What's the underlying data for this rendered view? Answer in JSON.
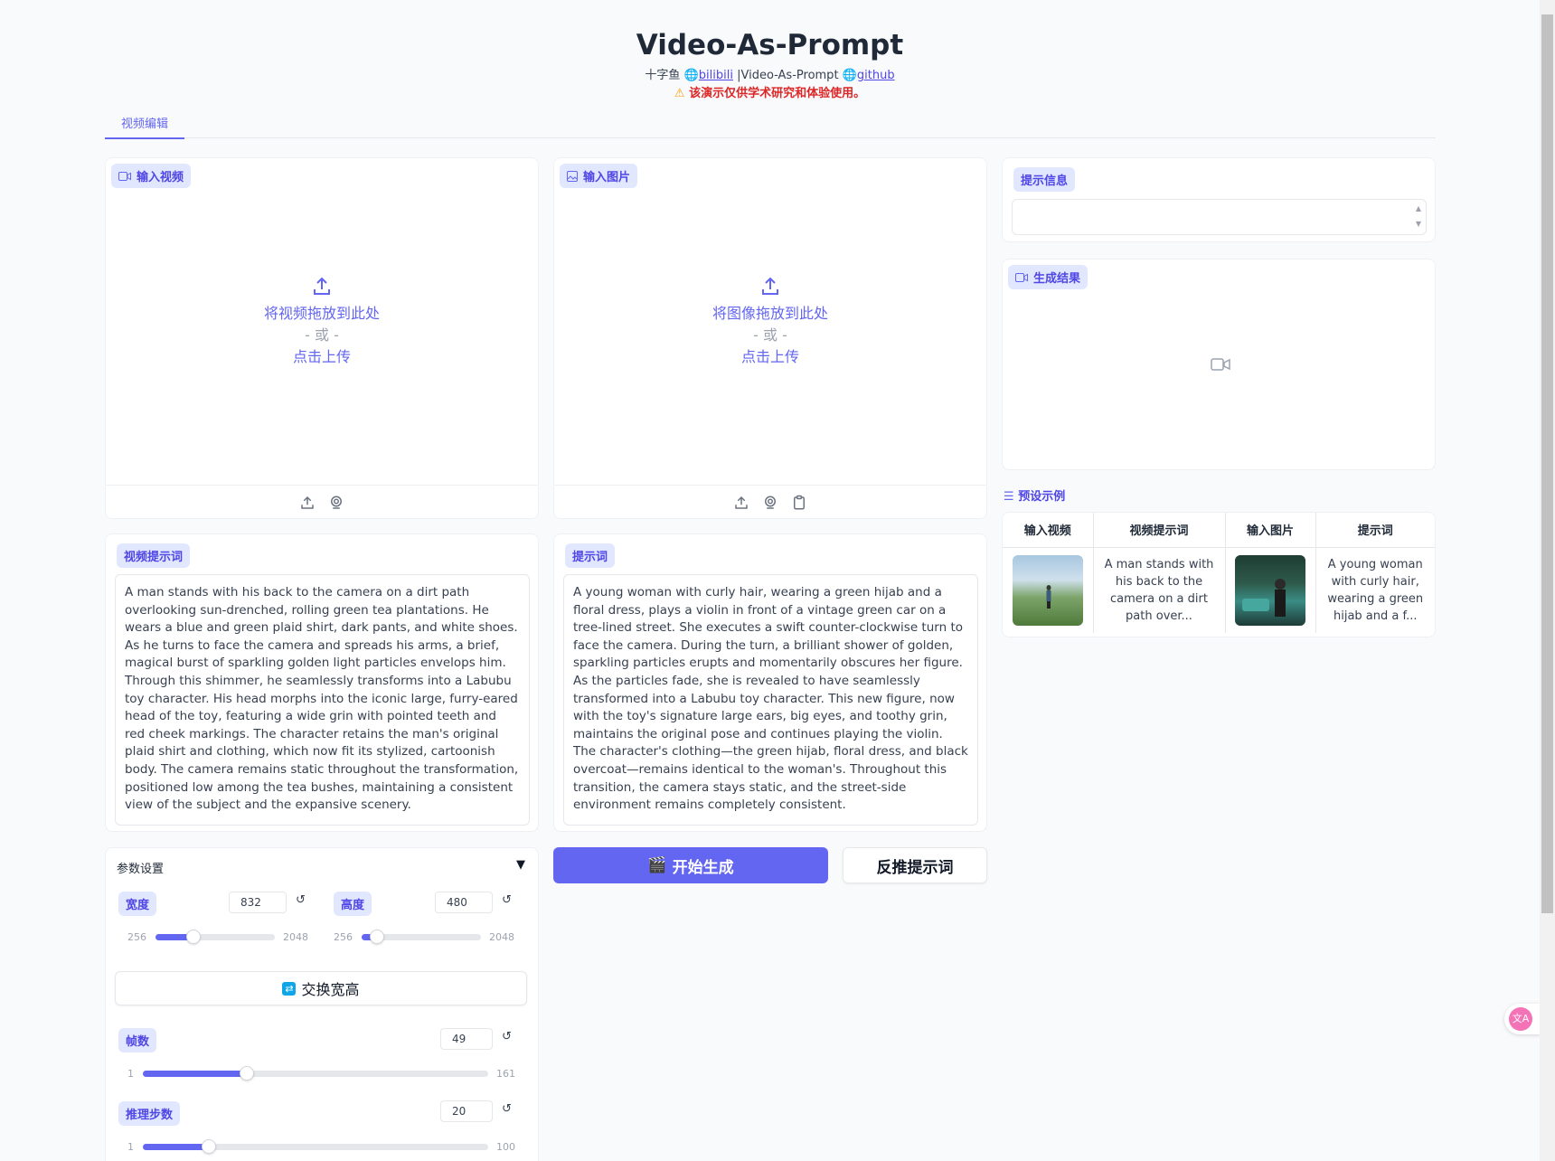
{
  "header": {
    "title": "Video-As-Prompt",
    "author": "十字鱼",
    "bilibili_label": "bilibili",
    "separator_text": "|Video-As-Prompt",
    "github_label": "github",
    "warning": "该演示仅供学术研究和体验使用。"
  },
  "tabs": [
    {
      "label": "视频编辑",
      "active": true
    }
  ],
  "video_input": {
    "label": "输入视频",
    "drop_text": "将视频拖放到此处",
    "or_text": "- 或 -",
    "click_text": "点击上传"
  },
  "image_input": {
    "label": "输入图片",
    "drop_text": "将图像拖放到此处",
    "or_text": "- 或 -",
    "click_text": "点击上传"
  },
  "info": {
    "label": "提示信息",
    "value": ""
  },
  "result": {
    "label": "生成结果"
  },
  "video_prompt": {
    "label": "视频提示词",
    "value": "A man stands with his back to the camera on a dirt path overlooking sun-drenched, rolling green tea plantations. He wears a blue and green plaid shirt, dark pants, and white shoes. As he turns to face the camera and spreads his arms, a brief, magical burst of sparkling golden light particles envelops him. Through this shimmer, he seamlessly transforms into a Labubu toy character. His head morphs into the iconic large, furry-eared head of the toy, featuring a wide grin with pointed teeth and red cheek markings. The character retains the man's original plaid shirt and clothing, which now fit its stylized, cartoonish body. The camera remains static throughout the transformation, positioned low among the tea bushes, maintaining a consistent view of the subject and the expansive scenery."
  },
  "prompt": {
    "label": "提示词",
    "value": "A young woman with curly hair, wearing a green hijab and a floral dress, plays a violin in front of a vintage green car on a tree-lined street. She executes a swift counter-clockwise turn to face the camera. During the turn, a brilliant shower of golden, sparkling particles erupts and momentarily obscures her figure. As the particles fade, she is revealed to have seamlessly transformed into a Labubu toy character. This new figure, now with the toy's signature large ears, big eyes, and toothy grin, maintains the original pose and continues playing the violin. The character's clothing—the green hijab, floral dress, and black overcoat—remains identical to the woman's. Throughout this transition, the camera stays static, and the street-side environment remains completely consistent."
  },
  "params": {
    "title": "参数设置",
    "collapse_glyph": "▼",
    "reset_glyph": "↺",
    "width": {
      "label": "宽度",
      "value": "832",
      "min": "256",
      "max": "2048",
      "num": 832,
      "lo": 256,
      "hi": 2048
    },
    "height": {
      "label": "高度",
      "value": "480",
      "min": "256",
      "max": "2048",
      "num": 480,
      "lo": 256,
      "hi": 2048
    },
    "swap_label": "交换宽高",
    "frames": {
      "label": "帧数",
      "value": "49",
      "min": "1",
      "max": "161",
      "num": 49,
      "lo": 1,
      "hi": 161
    },
    "steps": {
      "label": "推理步数",
      "value": "20",
      "min": "1",
      "max": "100",
      "num": 20,
      "lo": 1,
      "hi": 100
    }
  },
  "actions": {
    "generate_label": "开始生成",
    "reverse_label": "反推提示词"
  },
  "examples": {
    "title": "预设示例",
    "headers": [
      "输入视频",
      "视频提示词",
      "输入图片",
      "提示词"
    ],
    "row": {
      "video_prompt": "A man stands with his back to the camera on a dirt path over...",
      "prompt": "A young woman with curly hair, wearing a green hijab and a f..."
    }
  },
  "colors": {
    "accent": "#6366f1",
    "warning": "#dc2626",
    "pill_bg": "#e0e7ff"
  }
}
